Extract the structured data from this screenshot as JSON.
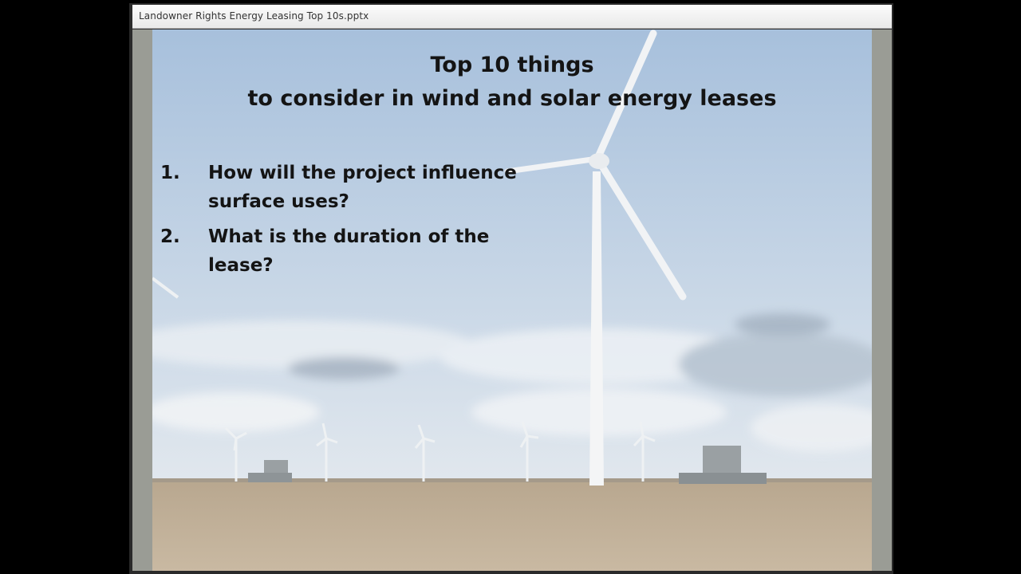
{
  "window": {
    "title": "Landowner Rights Energy Leasing Top 10s.pptx"
  },
  "slide": {
    "title_line1": "Top 10 things",
    "title_line2": "to consider in wind and solar energy leases",
    "items": [
      {
        "number": "1.",
        "text": "How will the project influence surface uses?"
      },
      {
        "number": "2.",
        "text": "What is the duration of the lease?"
      }
    ],
    "background": "photo of wind turbines over a harvested field with combines"
  },
  "colors": {
    "sky_top": "#a9c2dd",
    "sky_bottom": "#d8e2ec",
    "field": "#bfae96",
    "text": "#141414"
  }
}
